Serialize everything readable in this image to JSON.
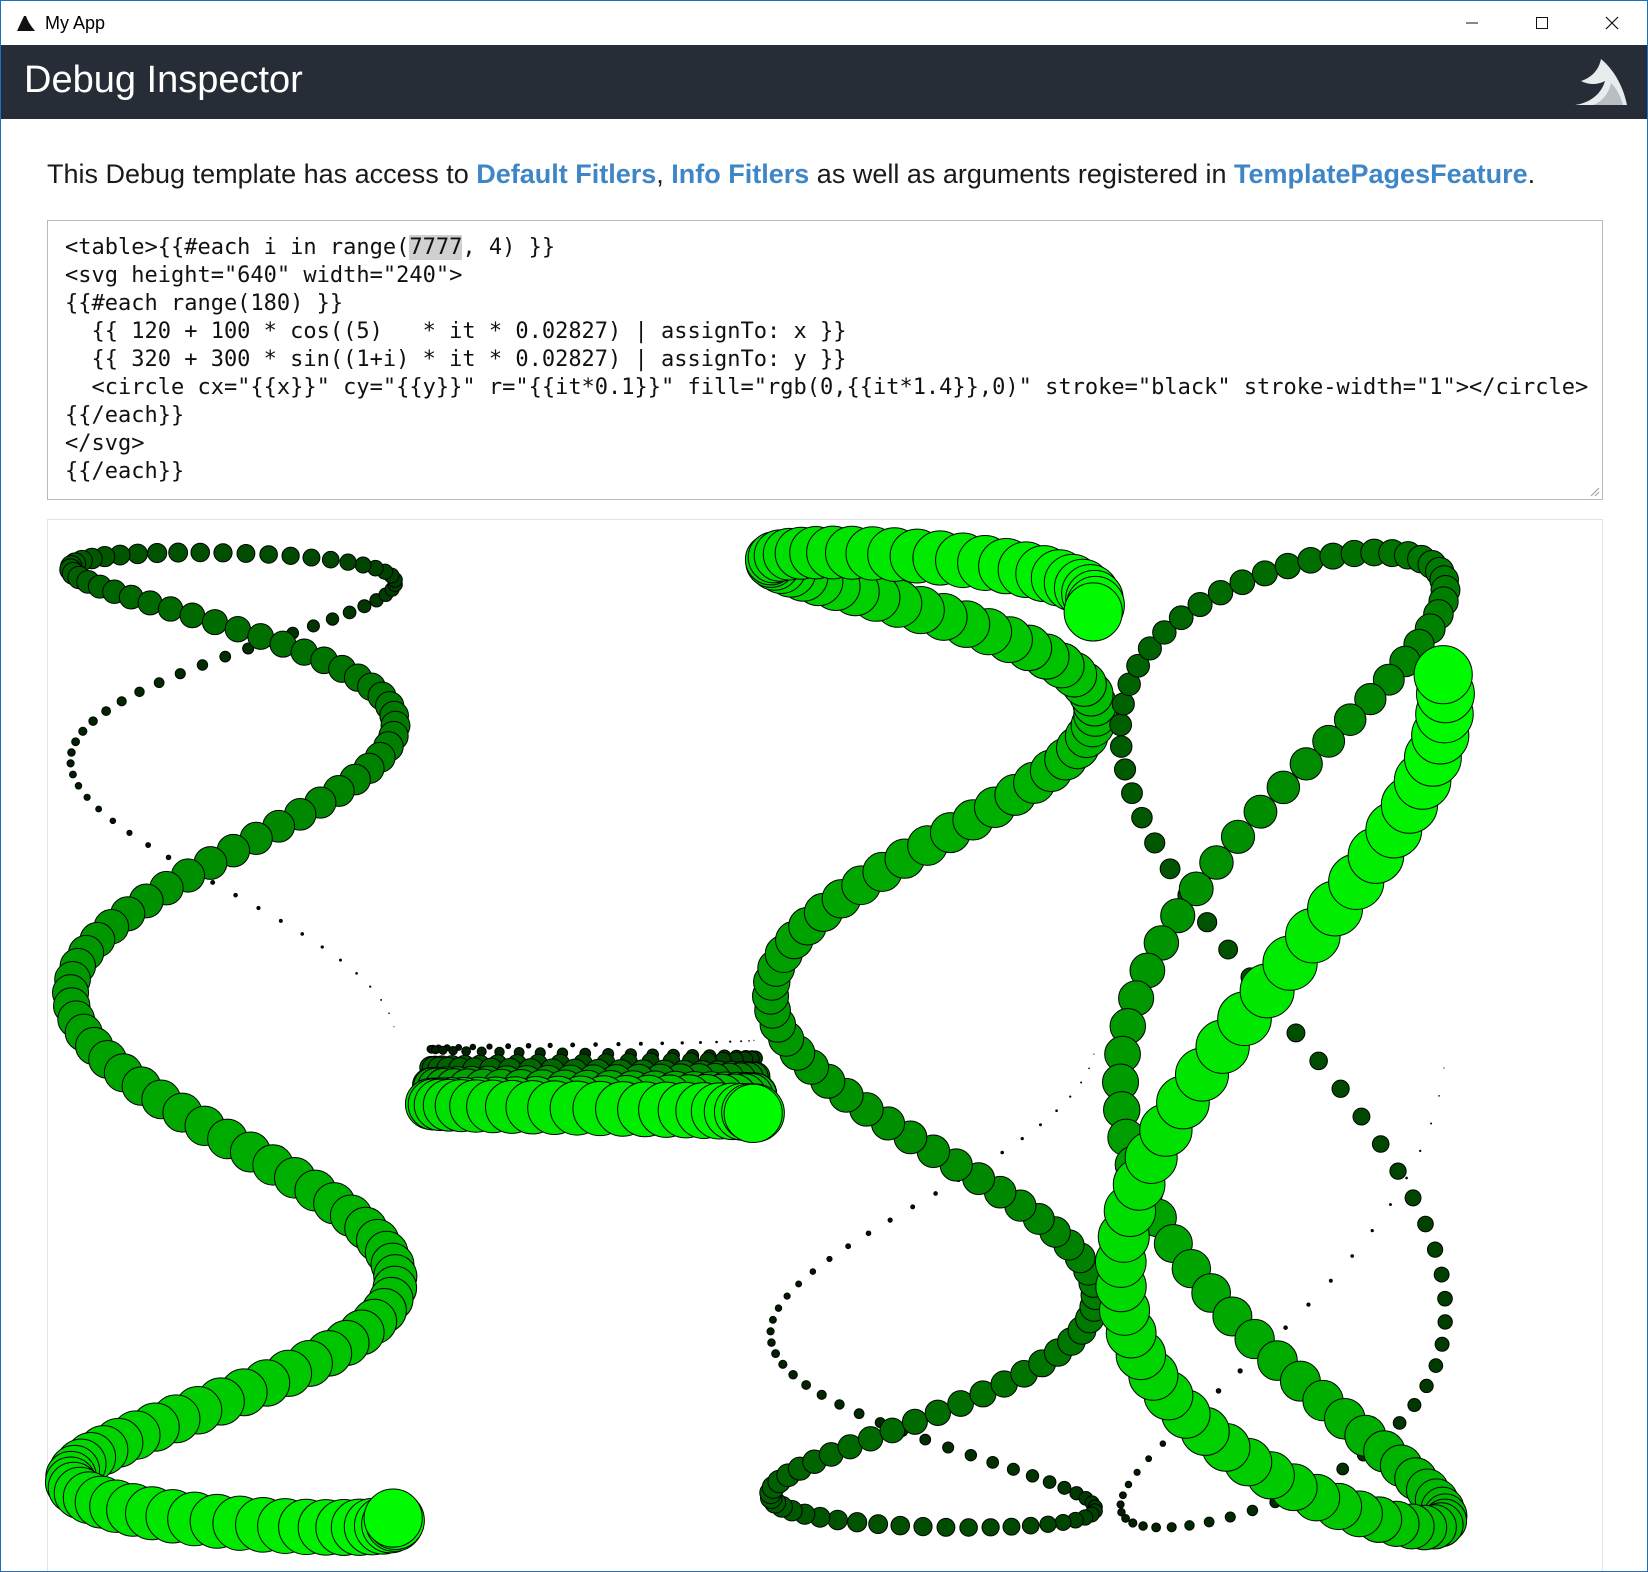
{
  "window": {
    "title": "My App",
    "controls": [
      "minimize",
      "maximize",
      "close"
    ]
  },
  "header": {
    "title": "Debug Inspector",
    "logo": "servicestack-logo"
  },
  "intro": {
    "text_before": "This Debug template has access to ",
    "link_default_filters": "Default Fitlers",
    "comma": ", ",
    "link_info_filters": "Info Fitlers",
    "text_middle": " as well as arguments registered in ",
    "link_feature": "TemplatePagesFeature",
    "text_end": "."
  },
  "editor": {
    "line1_before": "<table>{{#each i in range(",
    "line1_selected": "7777",
    "line1_after": ", 4) }}",
    "lines_rest": [
      "<svg height=\"640\" width=\"240\">",
      "{{#each range(180) }}",
      "  {{ 120 + 100 * cos((5)   * it * 0.02827) | assignTo: x }}",
      "  {{ 320 + 300 * sin((1+i) * it * 0.02827) | assignTo: y }}",
      "  <circle cx=\"{{x}}\" cy=\"{{y}}\" r=\"{{it*0.1}}\" fill=\"rgb(0,{{it*1.4}},0)\" stroke=\"black\" stroke-width=\"1\"></circle>",
      "{{/each}}",
      "</svg>",
      "{{/each}}"
    ]
  },
  "output": {
    "range_start": 7777,
    "range_count": 4,
    "points_per_svg": 180,
    "svg_height": 640,
    "svg_width": 240,
    "cx_base": 120,
    "cx_amp": 100,
    "cx_freq": 5,
    "cy_base": 320,
    "cy_amp": 300,
    "step": 0.02827,
    "radius_factor": 0.1,
    "green_factor": 1.4,
    "stroke": "black",
    "stroke_width": 1
  },
  "colors": {
    "header_bg": "#262d36",
    "link": "#3f86c7",
    "window_border": "#1e6fc0"
  }
}
